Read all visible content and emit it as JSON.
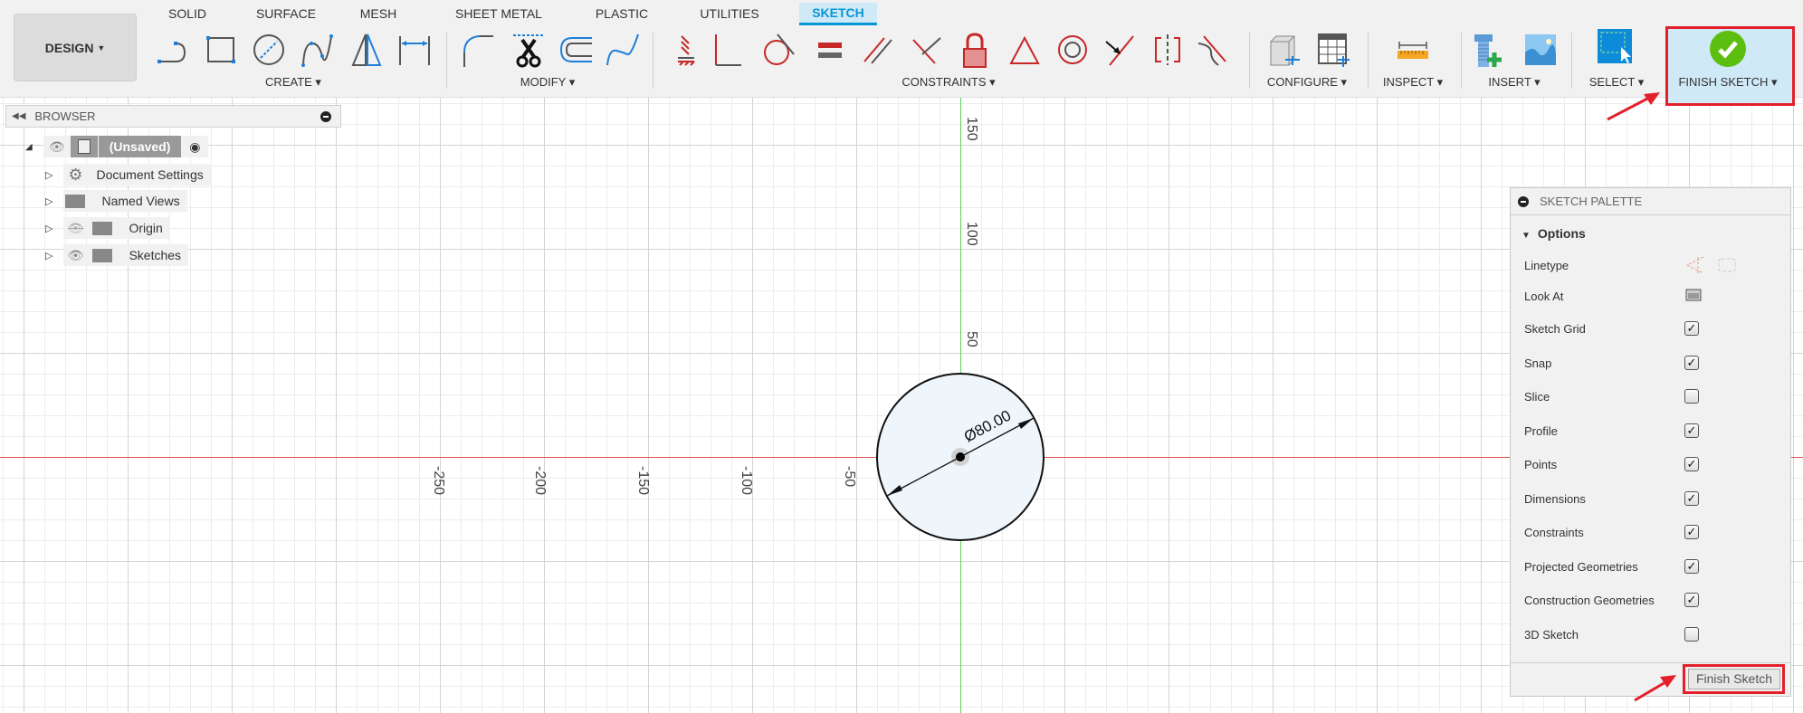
{
  "workspace": {
    "label": "DESIGN"
  },
  "tabs": [
    {
      "label": "SOLID"
    },
    {
      "label": "SURFACE"
    },
    {
      "label": "MESH"
    },
    {
      "label": "SHEET METAL"
    },
    {
      "label": "PLASTIC"
    },
    {
      "label": "UTILITIES"
    },
    {
      "label": "SKETCH",
      "active": true
    }
  ],
  "groups": {
    "create": "CREATE",
    "modify": "MODIFY",
    "constraints": "CONSTRAINTS",
    "configure": "CONFIGURE",
    "inspect": "INSPECT",
    "insert": "INSERT",
    "select": "SELECT",
    "finish": "FINISH SKETCH"
  },
  "browser": {
    "title": "BROWSER",
    "items": [
      {
        "label": "(Unsaved)"
      },
      {
        "label": "Document Settings"
      },
      {
        "label": "Named Views"
      },
      {
        "label": "Origin"
      },
      {
        "label": "Sketches"
      }
    ]
  },
  "canvas": {
    "x_labels": [
      "-250",
      "-200",
      "-150",
      "-100",
      "-50"
    ],
    "y_labels": [
      "150",
      "100",
      "50"
    ],
    "dimension": "Ø80.00",
    "colors": {
      "x_axis": "#e05050",
      "y_axis": "#5ccf5c",
      "profile_fill": "#eef6fc"
    }
  },
  "palette": {
    "title": "SKETCH PALETTE",
    "section": "Options",
    "linetype": "Linetype",
    "look_at": "Look At",
    "options": [
      {
        "label": "Sketch Grid",
        "checked": true
      },
      {
        "label": "Snap",
        "checked": true
      },
      {
        "label": "Slice",
        "checked": false
      },
      {
        "label": "Profile",
        "checked": true
      },
      {
        "label": "Points",
        "checked": true
      },
      {
        "label": "Dimensions",
        "checked": true
      },
      {
        "label": "Constraints",
        "checked": true
      },
      {
        "label": "Projected Geometries",
        "checked": true
      },
      {
        "label": "Construction Geometries",
        "checked": true
      },
      {
        "label": "3D Sketch",
        "checked": false
      }
    ],
    "finish": "Finish Sketch"
  },
  "accent": {
    "highlight": "#e3202a",
    "brand": "#0696d7"
  }
}
